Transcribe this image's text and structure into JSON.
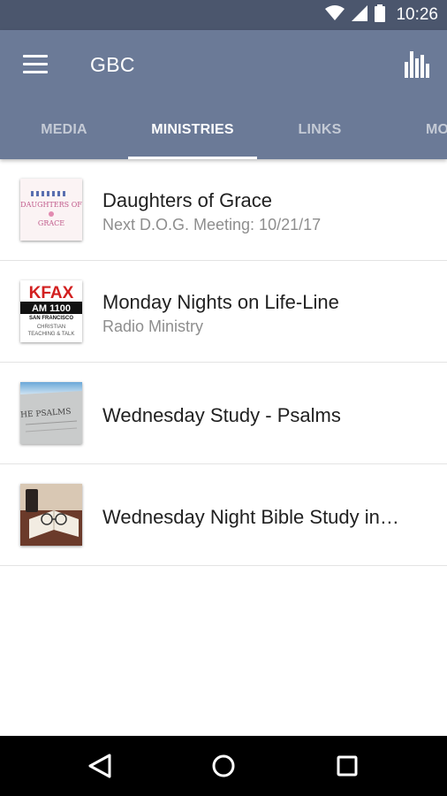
{
  "status_bar": {
    "time": "10:26",
    "icons": [
      "wifi-icon",
      "cell-signal-icon",
      "battery-icon"
    ]
  },
  "app_bar": {
    "title": "GBC",
    "menu_icon": "hamburger-menu-icon",
    "action_icon": "bar-chart-icon"
  },
  "tabs": [
    {
      "label": "MEDIA",
      "active": false
    },
    {
      "label": "MINISTRIES",
      "active": true
    },
    {
      "label": "LINKS",
      "active": false
    },
    {
      "label": "MO",
      "active": false
    }
  ],
  "ministries": [
    {
      "title": "Daughters of Grace",
      "subtitle": "Next D.O.G. Meeting: 10/21/17",
      "thumb_text_top": "DAUGHTERS OF",
      "thumb_text_bottom": "GRACE"
    },
    {
      "title": "Monday Nights on Life-Line",
      "subtitle": "Radio Ministry",
      "thumb_line1": "KFAX",
      "thumb_line2": "AM 1100",
      "thumb_line3": "SAN FRANCISCO",
      "thumb_line4": "CHRISTIAN",
      "thumb_line5": "TEACHING & TALK"
    },
    {
      "title": "Wednesday Study - Psalms",
      "subtitle": "",
      "thumb_text": "THE PSALMS"
    },
    {
      "title": "Wednesday Night Bible Study in…",
      "subtitle": ""
    }
  ],
  "colors": {
    "status_bar": "#4b566d",
    "app_bar": "#6b7a97",
    "nav_bar": "#000000"
  },
  "nav_bar": {
    "buttons": [
      "back-icon",
      "home-icon",
      "recents-icon"
    ]
  }
}
